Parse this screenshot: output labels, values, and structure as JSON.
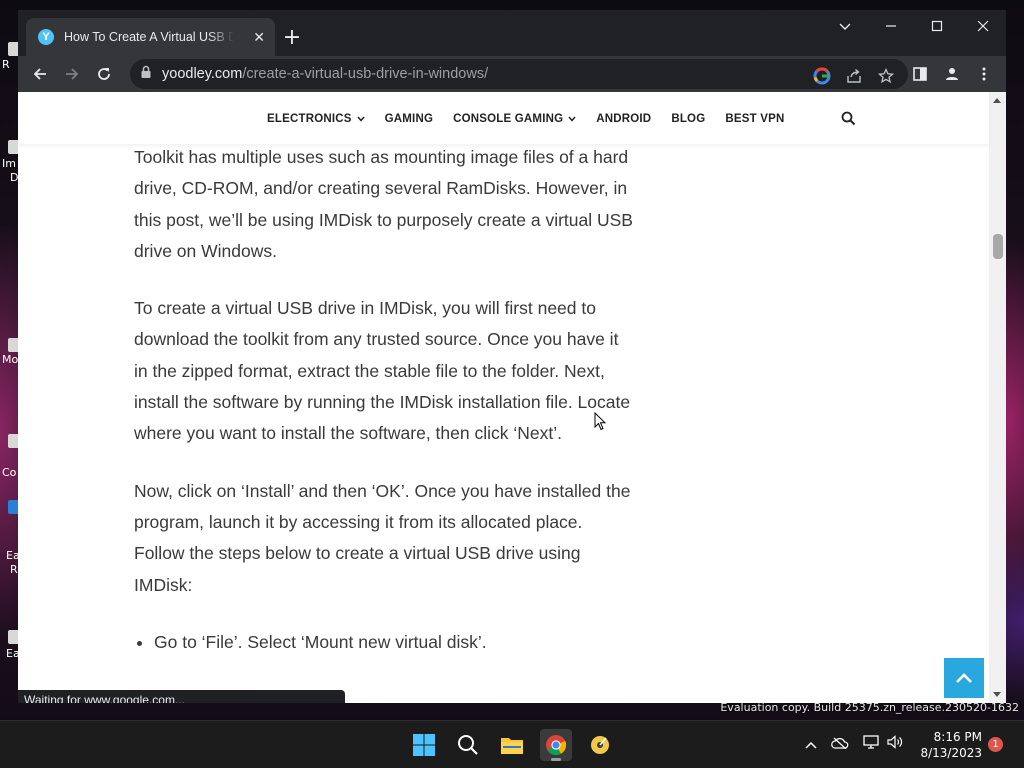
{
  "browser": {
    "tab_title": "How To Create A Virtual USB Drive In Windows",
    "favicon_letter": "Y",
    "url_domain": "yoodley.com",
    "url_path": "/create-a-virtual-usb-drive-in-windows/",
    "status_text": "Waiting for www.google.com..."
  },
  "site_nav": {
    "items": [
      {
        "label": "ELECTRONICS",
        "has_dropdown": true
      },
      {
        "label": "GAMING",
        "has_dropdown": false
      },
      {
        "label": "CONSOLE GAMING",
        "has_dropdown": true
      },
      {
        "label": "ANDROID",
        "has_dropdown": false
      },
      {
        "label": "BLOG",
        "has_dropdown": false
      },
      {
        "label": "BEST VPN",
        "has_dropdown": false
      }
    ]
  },
  "article": {
    "paragraphs": [
      "Toolkit has multiple uses such as mounting image files of a hard drive, CD-ROM, and/or creating several RamDisks. However, in this post, we’ll be using IMDisk to purposely create a virtual USB drive on Windows.",
      "To create a virtual USB drive in IMDisk, you will first need to download the toolkit from any trusted source. Once you have it in the zipped format, extract the stable file to the folder. Next, install the software by running the IMDisk installation file. Locate where you want to install the software, then click ‘Next’.",
      "Now, click on ‘Install’ and then ‘OK’. Once you have installed the program, launch it by accessing it from its allocated place. Follow the steps below to create a virtual USB drive using IMDisk:"
    ],
    "list_items": [
      "Go to ‘File’. Select ‘Mount new virtual disk’."
    ]
  },
  "desktop": {
    "watermark": "Evaluation copy. Build 25375.zn_release.230520-1632",
    "labels": [
      "R",
      "Im",
      "D",
      "Mo",
      "Co",
      "Ea",
      "R",
      "Ea"
    ]
  },
  "taskbar": {
    "time": "8:16 PM",
    "date": "8/13/2023",
    "notification_count": "1"
  },
  "colors": {
    "accent_blue": "#29a8e0",
    "chrome_dark": "#202124",
    "chrome_toolbar": "#35363a"
  }
}
